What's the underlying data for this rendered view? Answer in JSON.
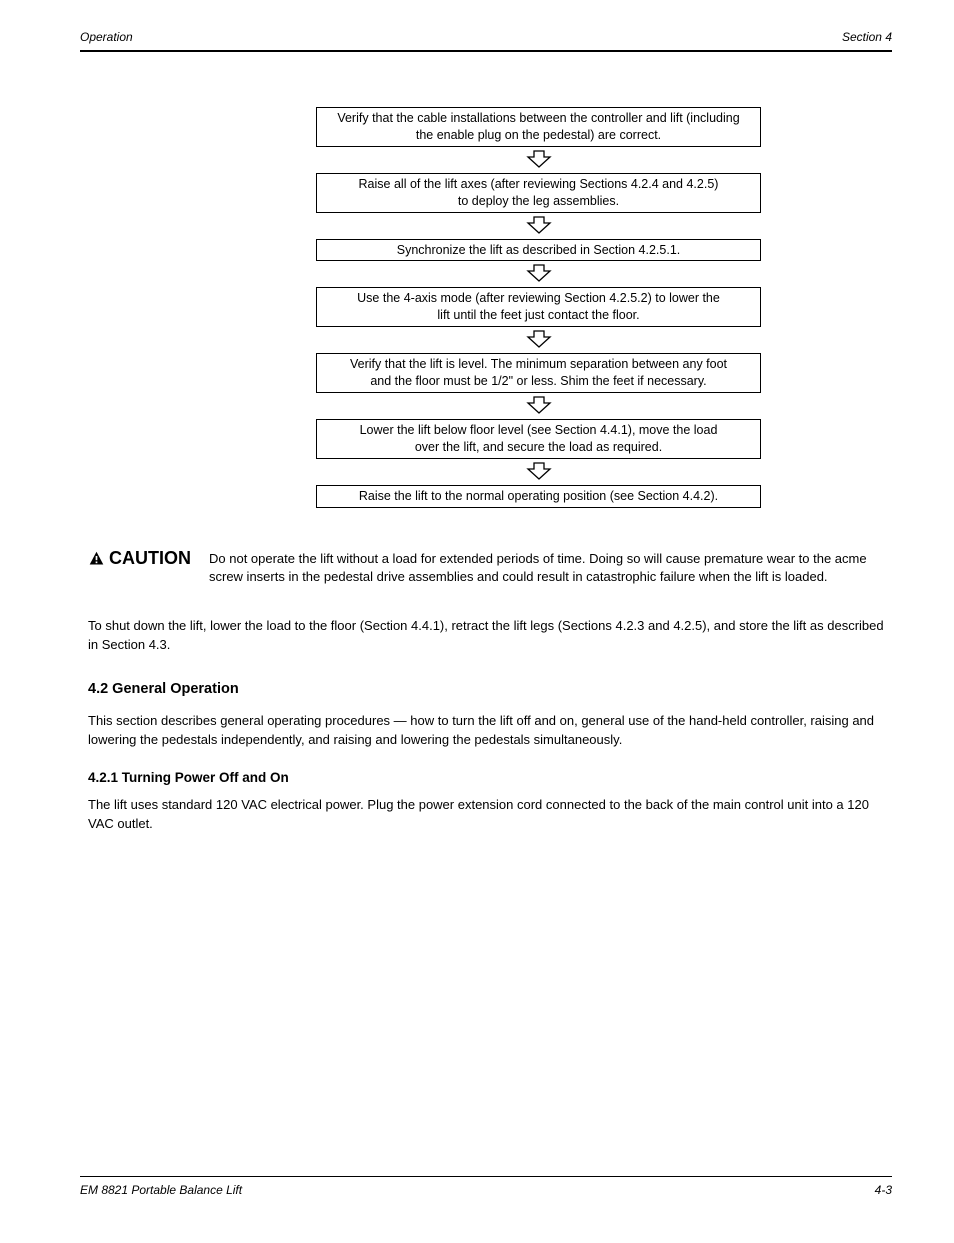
{
  "header": {
    "left": "Operation",
    "right": "Section 4"
  },
  "flow": [
    "Verify that the cable installations between the controller and lift (including\nthe enable plug on the pedestal) are correct.",
    "Raise all of the lift axes (after reviewing Sections 4.2.4 and 4.2.5)\nto deploy the leg assemblies.",
    "Synchronize the lift as described in Section 4.2.5.1.",
    "Use the 4-axis mode (after reviewing Section 4.2.5.2) to lower the\nlift until the feet just contact the floor.",
    "Verify that the lift is level. The minimum separation between any foot\nand the floor must be 1/2\" or less. Shim the feet if necessary.",
    "Lower the lift below floor level (see Section 4.4.1), move the load\nover the lift, and secure the load as required.",
    "Raise the lift to the normal operating position (see Section 4.4.2)."
  ],
  "caution": {
    "label": "CAUTION",
    "text": "Do not operate the lift without a load for extended periods of time. Doing so will cause premature wear to the acme screw inserts in the pedestal drive assemblies and could result in catastrophic failure when the lift is loaded."
  },
  "body": {
    "p1": "To shut down the lift, lower the load to the floor (Section 4.4.1), retract the lift legs (Sections 4.2.3 and 4.2.5), and store the lift as described in Section 4.3.",
    "h1": "4.2     General Operation",
    "p2": "This section describes general operating procedures — how to turn the lift off and on, general use of the hand-held controller, raising and lowering the pedestals independently, and raising and lowering the pedestals simultaneously.",
    "h2": "4.2.1   Turning Power Off and On",
    "p3": "The lift uses standard 120 VAC electrical power. Plug the power extension cord connected to the back of the main control unit into a 120 VAC outlet."
  },
  "footer": {
    "left": "EM 8821 Portable Balance Lift",
    "right": "4-3"
  }
}
